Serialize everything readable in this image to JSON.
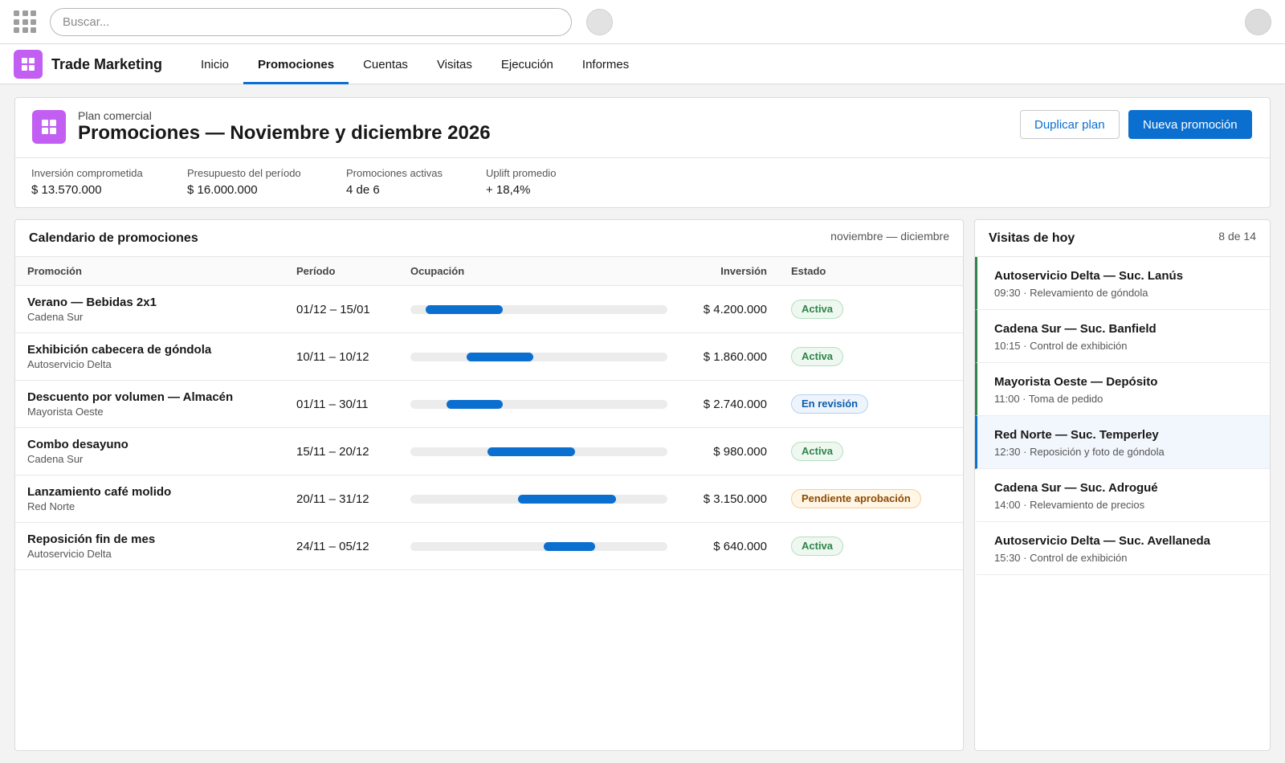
{
  "colors": {
    "brand": "#0b6fd0",
    "app_icon": "#c35ef2",
    "status_active": "#2e844a",
    "status_review": "#0b5cab",
    "status_pending": "#8c4b02"
  },
  "topbar": {
    "search_placeholder": "Buscar...",
    "icons": [
      "app-launcher-icon",
      "circle-button",
      "avatar"
    ]
  },
  "nav": {
    "app_name": "Trade Marketing",
    "tabs": [
      {
        "label": "Inicio",
        "active": false
      },
      {
        "label": "Promociones",
        "active": true
      },
      {
        "label": "Cuentas",
        "active": false
      },
      {
        "label": "Visitas",
        "active": false
      },
      {
        "label": "Ejecución",
        "active": false
      },
      {
        "label": "Informes",
        "active": false
      }
    ]
  },
  "header": {
    "eyebrow": "Plan comercial",
    "title": "Promociones — Noviembre y diciembre 2026",
    "duplicate_label": "Duplicar plan",
    "new_label": "Nueva promoción",
    "kpis": [
      {
        "label": "Inversión comprometida",
        "value": "$ 13.570.000"
      },
      {
        "label": "Presupuesto del período",
        "value": "$ 16.000.000"
      },
      {
        "label": "Promociones activas",
        "value": "4 de 6"
      },
      {
        "label": "Uplift promedio",
        "value": "+ 18,4%"
      }
    ]
  },
  "calendar": {
    "title": "Calendario de promociones",
    "range": "noviembre — diciembre",
    "columns": {
      "promocion": "Promoción",
      "periodo": "Período",
      "ocupacion": "Ocupación",
      "inversion": "Inversión",
      "estado": "Estado"
    },
    "rows": [
      {
        "name": "Verano — Bebidas 2x1",
        "account": "Cadena Sur",
        "period": "01/12 – 15/01",
        "occ_start": 0.06,
        "occ_end": 0.36,
        "investment": "$ 4.200.000",
        "status": "Activa",
        "status_kind": "green"
      },
      {
        "name": "Exhibición cabecera de góndola",
        "account": "Autoservicio Delta",
        "period": "10/11 – 10/12",
        "occ_start": 0.22,
        "occ_end": 0.48,
        "investment": "$ 1.860.000",
        "status": "Activa",
        "status_kind": "green"
      },
      {
        "name": "Descuento por volumen — Almacén",
        "account": "Mayorista Oeste",
        "period": "01/11 – 30/11",
        "occ_start": 0.14,
        "occ_end": 0.36,
        "investment": "$ 2.740.000",
        "status": "En revisión",
        "status_kind": "blue"
      },
      {
        "name": "Combo desayuno",
        "account": "Cadena Sur",
        "period": "15/11 – 20/12",
        "occ_start": 0.3,
        "occ_end": 0.64,
        "investment": "$ 980.000",
        "status": "Activa",
        "status_kind": "green"
      },
      {
        "name": "Lanzamiento café molido",
        "account": "Red Norte",
        "period": "20/11 – 31/12",
        "occ_start": 0.42,
        "occ_end": 0.8,
        "investment": "$ 3.150.000",
        "status": "Pendiente aprobación",
        "status_kind": "amber"
      },
      {
        "name": "Reposición fin de mes",
        "account": "Autoservicio Delta",
        "period": "24/11 – 05/12",
        "occ_start": 0.52,
        "occ_end": 0.72,
        "investment": "$ 640.000",
        "status": "Activa",
        "status_kind": "green"
      }
    ]
  },
  "visits": {
    "title": "Visitas de hoy",
    "count": "8 de 14",
    "items": [
      {
        "title": "Autoservicio Delta — Suc. Lanús",
        "detail": "09:30 · Relevamiento de góndola",
        "state": "done"
      },
      {
        "title": "Cadena Sur — Suc. Banfield",
        "detail": "10:15 · Control de exhibición",
        "state": "done"
      },
      {
        "title": "Mayorista Oeste — Depósito",
        "detail": "11:00 · Toma de pedido",
        "state": "done"
      },
      {
        "title": "Red Norte — Suc. Temperley",
        "detail": "12:30 · Reposición y foto de góndola",
        "state": "current"
      },
      {
        "title": "Cadena Sur — Suc. Adrogué",
        "detail": "14:00 · Relevamiento de precios",
        "state": "pending"
      },
      {
        "title": "Autoservicio Delta — Suc. Avellaneda",
        "detail": "15:30 · Control de exhibición",
        "state": "pending"
      }
    ]
  }
}
